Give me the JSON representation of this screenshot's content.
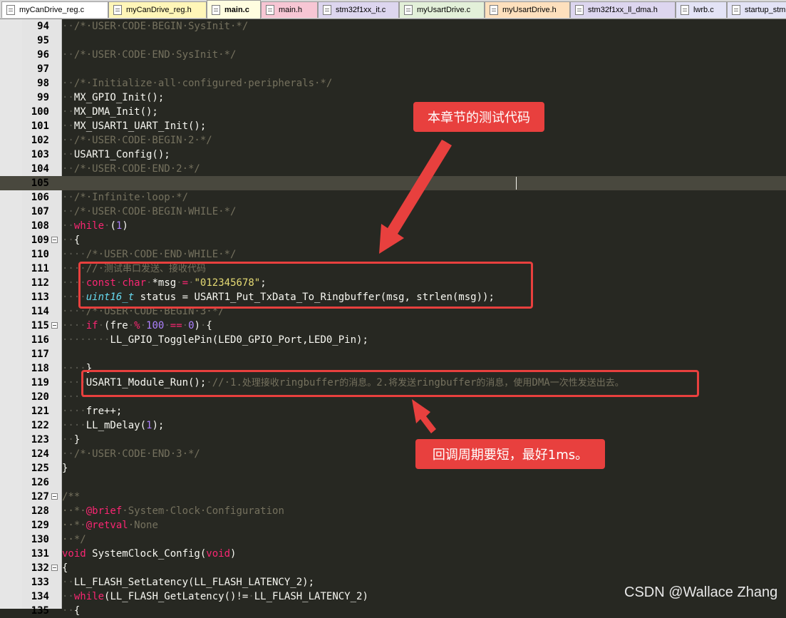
{
  "tabs": [
    {
      "label": "myCanDrive_reg.c",
      "color": "#ffffff",
      "active": false
    },
    {
      "label": "myCanDrive_reg.h",
      "color": "#fff6b8",
      "active": false
    },
    {
      "label": "main.c",
      "color": "#fffde0",
      "active": true
    },
    {
      "label": "main.h",
      "color": "#f7c6d4",
      "active": false
    },
    {
      "label": "stm32f1xx_it.c",
      "color": "#ddd6ef",
      "active": false
    },
    {
      "label": "myUsartDrive.c",
      "color": "#e3f0d9",
      "active": false
    },
    {
      "label": "myUsartDrive.h",
      "color": "#fde0bd",
      "active": false
    },
    {
      "label": "stm32f1xx_ll_dma.h",
      "color": "#ddd6ef",
      "active": false
    },
    {
      "label": "lwrb.c",
      "color": "#e3e3f6",
      "active": false
    },
    {
      "label": "startup_stm",
      "color": "#e3e3f6",
      "active": false
    }
  ],
  "editor": {
    "current_line": 105,
    "lines": [
      {
        "n": 94,
        "fold": false,
        "t": [
          [
            "ws",
            "··"
          ],
          [
            "cm",
            "/*·USER·CODE·BEGIN·SysInit·*/"
          ]
        ]
      },
      {
        "n": 95,
        "fold": false,
        "t": []
      },
      {
        "n": 96,
        "fold": false,
        "t": [
          [
            "ws",
            "··"
          ],
          [
            "cm",
            "/*·USER·CODE·END·SysInit·*/"
          ]
        ]
      },
      {
        "n": 97,
        "fold": false,
        "t": []
      },
      {
        "n": 98,
        "fold": false,
        "t": [
          [
            "ws",
            "··"
          ],
          [
            "cm",
            "/*·Initialize·all·configured·peripherals·*/"
          ]
        ]
      },
      {
        "n": 99,
        "fold": false,
        "t": [
          [
            "ws",
            "··"
          ],
          [
            "",
            "MX_GPIO_Init();"
          ]
        ]
      },
      {
        "n": 100,
        "fold": false,
        "t": [
          [
            "ws",
            "··"
          ],
          [
            "",
            "MX_DMA_Init();"
          ]
        ]
      },
      {
        "n": 101,
        "fold": false,
        "t": [
          [
            "ws",
            "··"
          ],
          [
            "",
            "MX_USART1_UART_Init();"
          ]
        ]
      },
      {
        "n": 102,
        "fold": false,
        "t": [
          [
            "ws",
            "··"
          ],
          [
            "cm",
            "/*·USER·CODE·BEGIN·2·*/"
          ]
        ]
      },
      {
        "n": 103,
        "fold": false,
        "t": [
          [
            "ws",
            "··"
          ],
          [
            "",
            "USART1_Config();"
          ]
        ]
      },
      {
        "n": 104,
        "fold": false,
        "t": [
          [
            "ws",
            "··"
          ],
          [
            "cm",
            "/*·USER·CODE·END·2·*/"
          ]
        ]
      },
      {
        "n": 105,
        "fold": false,
        "t": []
      },
      {
        "n": 106,
        "fold": false,
        "t": [
          [
            "ws",
            "··"
          ],
          [
            "cm",
            "/*·Infinite·loop·*/"
          ]
        ]
      },
      {
        "n": 107,
        "fold": false,
        "t": [
          [
            "ws",
            "··"
          ],
          [
            "cm",
            "/*·USER·CODE·BEGIN·WHILE·*/"
          ]
        ]
      },
      {
        "n": 108,
        "fold": false,
        "t": [
          [
            "ws",
            "··"
          ],
          [
            "kw",
            "while"
          ],
          [
            "ws",
            "·"
          ],
          [
            "",
            "("
          ],
          [
            "num",
            "1"
          ],
          [
            "",
            ")"
          ]
        ]
      },
      {
        "n": 109,
        "fold": true,
        "t": [
          [
            "ws",
            "··"
          ],
          [
            "",
            "{"
          ]
        ]
      },
      {
        "n": 110,
        "fold": false,
        "t": [
          [
            "ws",
            "····"
          ],
          [
            "cm",
            "/*·USER·CODE·END·WHILE·*/"
          ]
        ]
      },
      {
        "n": 111,
        "fold": false,
        "t": [
          [
            "ws",
            "····"
          ],
          [
            "cm",
            "//·"
          ],
          [
            "cm cmcn",
            "测试串口发送、接收代码"
          ]
        ]
      },
      {
        "n": 112,
        "fold": false,
        "t": [
          [
            "ws",
            "····"
          ],
          [
            "kw",
            "const"
          ],
          [
            "ws",
            "·"
          ],
          [
            "kw",
            "char"
          ],
          [
            "ws",
            "·"
          ],
          [
            "",
            "*msg"
          ],
          [
            "ws",
            "·"
          ],
          [
            "kw",
            "="
          ],
          [
            "ws",
            "·"
          ],
          [
            "str",
            "\"012345678\""
          ],
          [
            "",
            ";"
          ]
        ]
      },
      {
        "n": 113,
        "fold": false,
        "t": [
          [
            "ws",
            "····"
          ],
          [
            "ty",
            "uint16_t"
          ],
          [
            "",
            " status = USART1_Put_TxData_To_Ringbuffer(msg, strlen(msg));"
          ]
        ]
      },
      {
        "n": 114,
        "fold": false,
        "t": [
          [
            "ws",
            "····"
          ],
          [
            "cm",
            "/*·USER·CODE·BEGIN·3·*/"
          ]
        ]
      },
      {
        "n": 115,
        "fold": true,
        "t": [
          [
            "ws",
            "····"
          ],
          [
            "kw",
            "if"
          ],
          [
            "ws",
            "·"
          ],
          [
            "",
            "(fre"
          ],
          [
            "ws",
            "·"
          ],
          [
            "kw",
            "%"
          ],
          [
            "ws",
            "·"
          ],
          [
            "num",
            "100"
          ],
          [
            "ws",
            "·"
          ],
          [
            "kw",
            "=="
          ],
          [
            "ws",
            "·"
          ],
          [
            "num",
            "0"
          ],
          [
            "",
            ")"
          ],
          [
            "ws",
            "·"
          ],
          [
            "",
            "{"
          ]
        ]
      },
      {
        "n": 116,
        "fold": false,
        "t": [
          [
            "ws",
            "········"
          ],
          [
            "",
            "LL_GPIO_TogglePin(LED0_GPIO_Port,LED0_Pin);"
          ]
        ]
      },
      {
        "n": 117,
        "fold": false,
        "t": []
      },
      {
        "n": 118,
        "fold": false,
        "t": [
          [
            "ws",
            "····"
          ],
          [
            "",
            "}"
          ]
        ]
      },
      {
        "n": 119,
        "fold": false,
        "t": [
          [
            "ws",
            "····"
          ],
          [
            "",
            "USART1_Module_Run();"
          ],
          [
            "ws",
            "·"
          ],
          [
            "cm",
            "//·1."
          ],
          [
            "cm cmcn",
            "处理接收"
          ],
          [
            "cm",
            "ringbuffer"
          ],
          [
            "cm cmcn",
            "的消息。"
          ],
          [
            "cm",
            "2."
          ],
          [
            "cm cmcn",
            "将发送"
          ],
          [
            "cm",
            "ringbuffer"
          ],
          [
            "cm cmcn",
            "的消息，使用"
          ],
          [
            "cm",
            "DMA"
          ],
          [
            "cm cmcn",
            "一次性发送出去。"
          ]
        ]
      },
      {
        "n": 120,
        "fold": false,
        "t": [
          [
            "ws",
            "····"
          ]
        ]
      },
      {
        "n": 121,
        "fold": false,
        "t": [
          [
            "ws",
            "····"
          ],
          [
            "",
            "fre++;"
          ]
        ]
      },
      {
        "n": 122,
        "fold": false,
        "t": [
          [
            "ws",
            "····"
          ],
          [
            "",
            "LL_mDelay("
          ],
          [
            "num",
            "1"
          ],
          [
            "",
            ");"
          ]
        ]
      },
      {
        "n": 123,
        "fold": false,
        "t": [
          [
            "ws",
            "··"
          ],
          [
            "",
            "}"
          ]
        ]
      },
      {
        "n": 124,
        "fold": false,
        "t": [
          [
            "ws",
            "··"
          ],
          [
            "cm",
            "/*·USER·CODE·END·3·*/"
          ]
        ]
      },
      {
        "n": 125,
        "fold": false,
        "t": [
          [
            "",
            "}"
          ]
        ]
      },
      {
        "n": 126,
        "fold": false,
        "t": []
      },
      {
        "n": 127,
        "fold": true,
        "t": [
          [
            "cm",
            "/**"
          ]
        ]
      },
      {
        "n": 128,
        "fold": false,
        "t": [
          [
            "cm",
            "··*·"
          ],
          [
            "kw",
            "@brief"
          ],
          [
            "cm",
            "·System·Clock·Configuration"
          ]
        ]
      },
      {
        "n": 129,
        "fold": false,
        "t": [
          [
            "cm",
            "··*·"
          ],
          [
            "kw",
            "@retval"
          ],
          [
            "cm",
            "·None"
          ]
        ]
      },
      {
        "n": 130,
        "fold": false,
        "t": [
          [
            "cm",
            "··*/"
          ]
        ]
      },
      {
        "n": 131,
        "fold": false,
        "t": [
          [
            "kw",
            "void"
          ],
          [
            "",
            " SystemClock_Config("
          ],
          [
            "kw",
            "void"
          ],
          [
            "",
            ")"
          ]
        ]
      },
      {
        "n": 132,
        "fold": true,
        "t": [
          [
            "",
            "{"
          ]
        ]
      },
      {
        "n": 133,
        "fold": false,
        "t": [
          [
            "ws",
            "··"
          ],
          [
            "",
            "LL_FLASH_SetLatency(LL_FLASH_LATENCY_2);"
          ]
        ]
      },
      {
        "n": 134,
        "fold": false,
        "t": [
          [
            "ws",
            "··"
          ],
          [
            "kw",
            "while"
          ],
          [
            "",
            "(LL_FLASH_GetLatency()!="
          ],
          [
            "ws",
            "·"
          ],
          [
            "",
            "LL_FLASH_LATENCY_2)"
          ]
        ]
      },
      {
        "n": 135,
        "fold": false,
        "t": [
          [
            "ws",
            "··"
          ],
          [
            "",
            "{"
          ]
        ]
      }
    ]
  },
  "annotations": {
    "callout_top": "本章节的测试代码",
    "callout_bottom": "回调周期要短，最好1ms。",
    "accent_color": "#e8403e"
  },
  "watermark": "CSDN @Wallace Zhang"
}
